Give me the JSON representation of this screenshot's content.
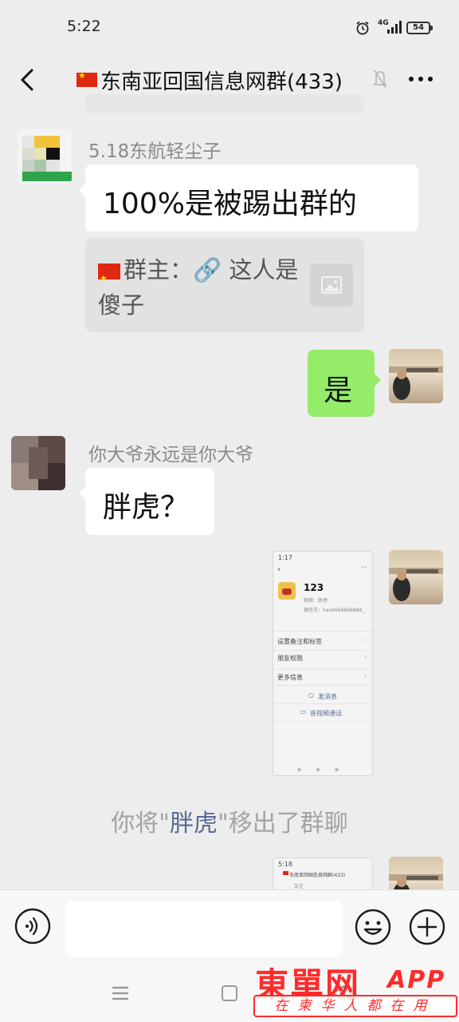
{
  "status_bar": {
    "time": "5:22",
    "network": "4G",
    "battery": "54"
  },
  "header": {
    "title": "东南亚回国信息网群(433)"
  },
  "messages": [
    {
      "sender": "5.18东航轻尘子",
      "text": "100%是被踢出群的",
      "quote": {
        "text": "群主：🔗 这人是傻子"
      }
    },
    {
      "from_me": true,
      "text": "是"
    },
    {
      "sender": "你大爷永远是你大爷",
      "text": "胖虎？"
    },
    {
      "from_me": true,
      "image": {
        "status_time": "1:17",
        "name": "123",
        "nickname": "昵称：胖虎",
        "wechat_id": "微信号：hao6666666888_",
        "rows": [
          "设置备注和标签",
          "朋友权限",
          "更多信息"
        ],
        "actions": [
          "发消息",
          "音视频通话"
        ]
      }
    },
    {
      "system": true,
      "prefix": "你将\"",
      "name": "胖虎",
      "suffix": "\"移出了群聊"
    },
    {
      "from_me": true,
      "image2": {
        "time": "5:18",
        "title": "东南亚回国信息网群(433)",
        "line": "又在"
      }
    }
  ],
  "input": {
    "placeholder": ""
  },
  "watermark": {
    "brand": "東單网",
    "app": "APP",
    "slogan": "在柬华人都在用"
  },
  "colors": {
    "bubble_green": "#95ec69",
    "background": "#ededed",
    "link_blue": "#576b95"
  }
}
